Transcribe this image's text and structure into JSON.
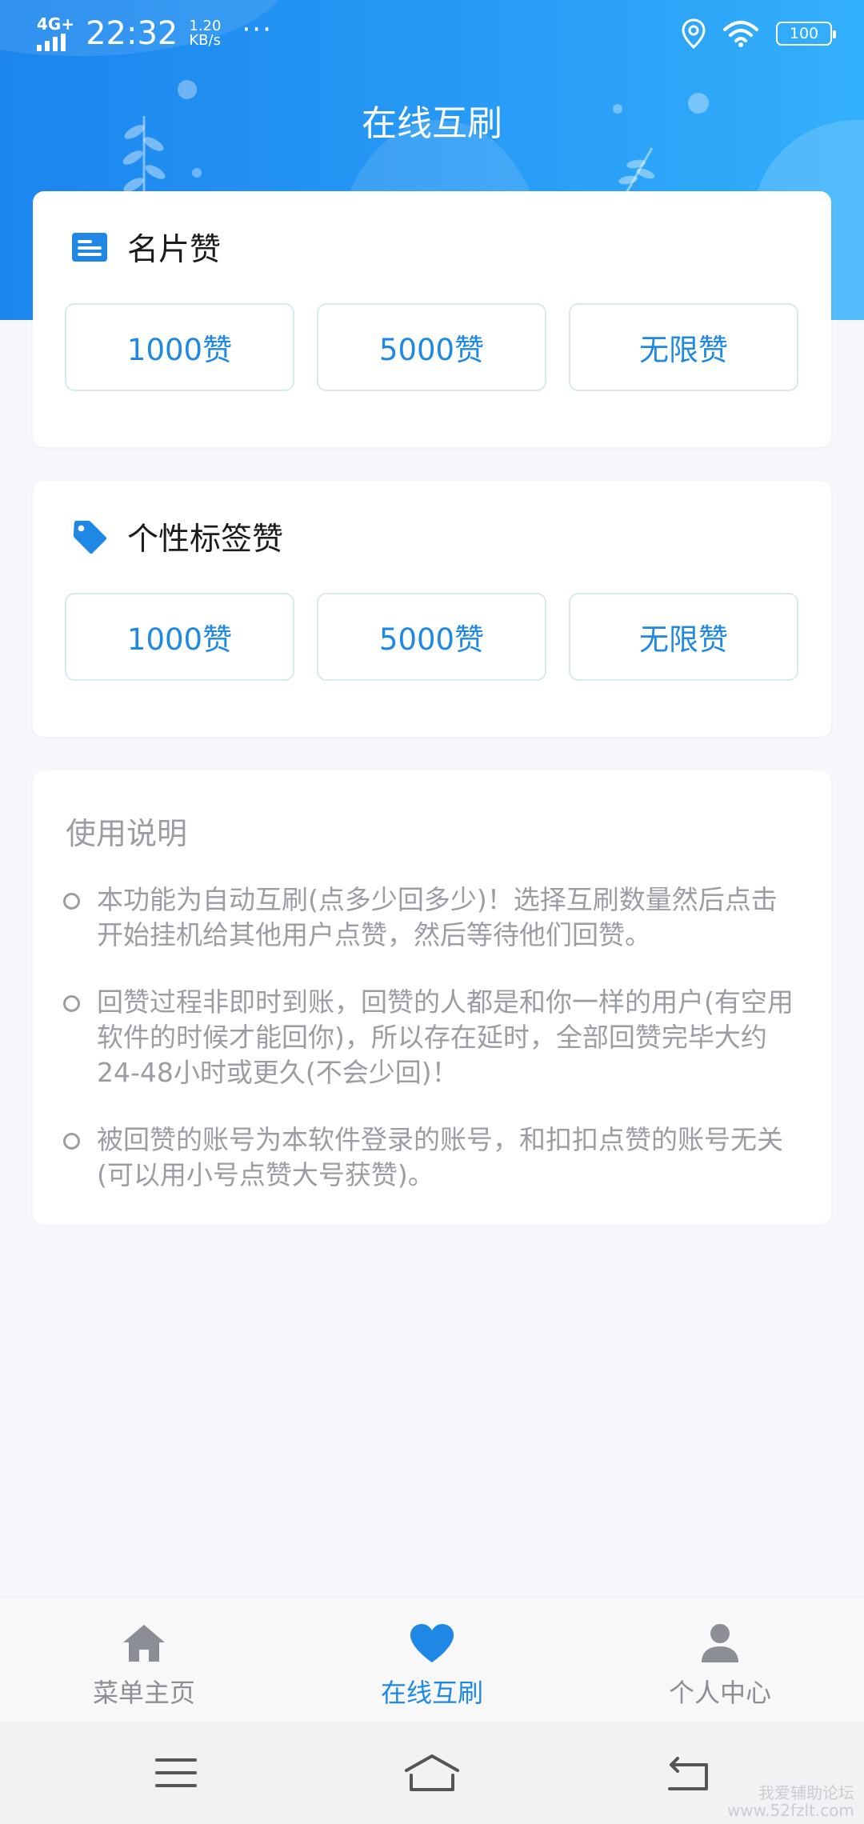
{
  "status_bar": {
    "network": "4G+",
    "time": "22:32",
    "speed_value": "1.20",
    "speed_unit": "KB/s",
    "more": "···",
    "battery": "100"
  },
  "page_title": "在线互刷",
  "card_likes": {
    "title": "名片赞",
    "icon": "business-card-icon",
    "options": [
      "1000赞",
      "5000赞",
      "无限赞"
    ]
  },
  "tag_likes": {
    "title": "个性标签赞",
    "icon": "tag-icon",
    "options": [
      "1000赞",
      "5000赞",
      "无限赞"
    ]
  },
  "instructions": {
    "title": "使用说明",
    "items": [
      "本功能为自动互刷(点多少回多少)！选择互刷数量然后点击开始挂机给其他用户点赞，然后等待他们回赞。",
      "回赞过程非即时到账，回赞的人都是和你一样的用户(有空用软件的时候才能回你)，所以存在延时，全部回赞完毕大约24-48小时或更久(不会少回)！",
      "被回赞的账号为本软件登录的账号，和扣扣点赞的账号无关(可以用小号点赞大号获赞)。"
    ]
  },
  "bottom_nav": {
    "items": [
      {
        "label": "菜单主页",
        "icon": "home-icon",
        "active": false
      },
      {
        "label": "在线互刷",
        "icon": "heart-icon",
        "active": true
      },
      {
        "label": "个人中心",
        "icon": "user-icon",
        "active": false
      }
    ]
  },
  "system_nav": [
    "menu-icon",
    "home-outline-icon",
    "back-icon"
  ],
  "watermark": [
    "我爱辅助论坛",
    "www.52fzlt.com"
  ],
  "colors": {
    "accent": "#1f88e5",
    "header_start": "#1b86ee",
    "header_end": "#33b0fb",
    "muted_text": "#9a9da3",
    "background": "#f6f7fb"
  }
}
